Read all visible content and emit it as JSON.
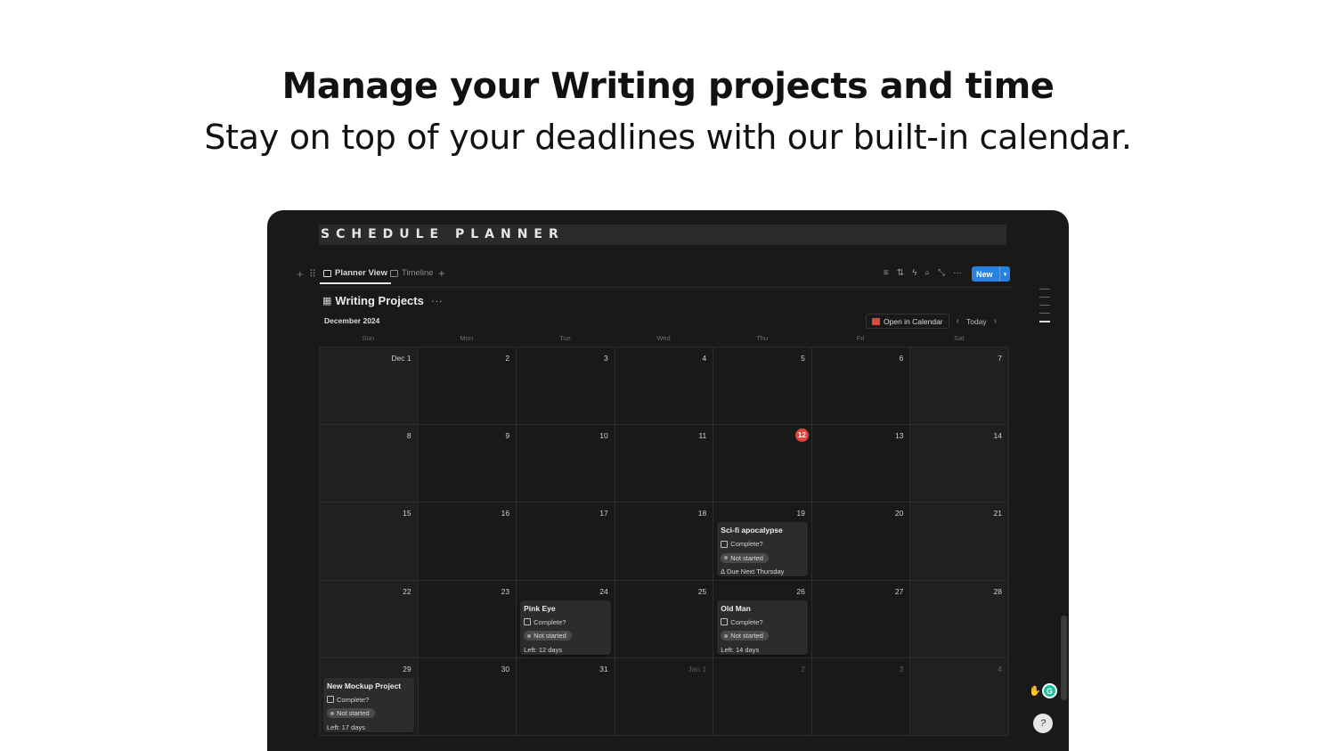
{
  "headline": "Manage your Writing projects and time",
  "subheadline": "Stay on top of your deadlines with our built-in calendar.",
  "app": {
    "banner_title": "SCHEDULE PLANNER",
    "views": [
      {
        "label": "Planner View",
        "icon": "calendar-view-icon",
        "active": true
      },
      {
        "label": "Timeline",
        "icon": "timeline-icon",
        "active": false
      }
    ],
    "toolbar": {
      "icons": [
        "filter-icon",
        "sort-icon",
        "automation-icon",
        "search-icon",
        "expand-icon",
        "more-icon"
      ],
      "new_label": "New"
    },
    "database_title": "Writing Projects",
    "month_label": "December 2024",
    "open_calendar_label": "Open in Calendar",
    "today_label": "Today",
    "weekdays": [
      "Sun",
      "Mon",
      "Tue",
      "Wed",
      "Thu",
      "Fri",
      "Sat"
    ],
    "days": [
      "Dec 1",
      "2",
      "3",
      "4",
      "5",
      "6",
      "7",
      "8",
      "9",
      "10",
      "11",
      "12",
      "13",
      "14",
      "15",
      "16",
      "17",
      "18",
      "19",
      "20",
      "21",
      "22",
      "23",
      "24",
      "25",
      "26",
      "27",
      "28",
      "29",
      "30",
      "31",
      "Jan 1",
      "2",
      "3",
      "4"
    ],
    "today_index": 11,
    "dim_from_index": 31,
    "events": [
      {
        "day_index": 18,
        "title": "Sci-fi apocalypse",
        "check_label": "Complete?",
        "status": "Not started",
        "note": "∆ Due Next Thursday"
      },
      {
        "day_index": 23,
        "title": "Pink Eye",
        "check_label": "Complete?",
        "status": "Not started",
        "note": "Left: 12 days"
      },
      {
        "day_index": 25,
        "title": "Old Man",
        "check_label": "Complete?",
        "status": "Not started",
        "note": "Left: 14 days"
      },
      {
        "day_index": 28,
        "title": "New Mockup Project",
        "check_label": "Complete?",
        "status": "Not started",
        "note": "Left: 17 days"
      }
    ]
  },
  "colors": {
    "background": "#191919",
    "accent": "#2783de",
    "today": "#e0443c"
  }
}
